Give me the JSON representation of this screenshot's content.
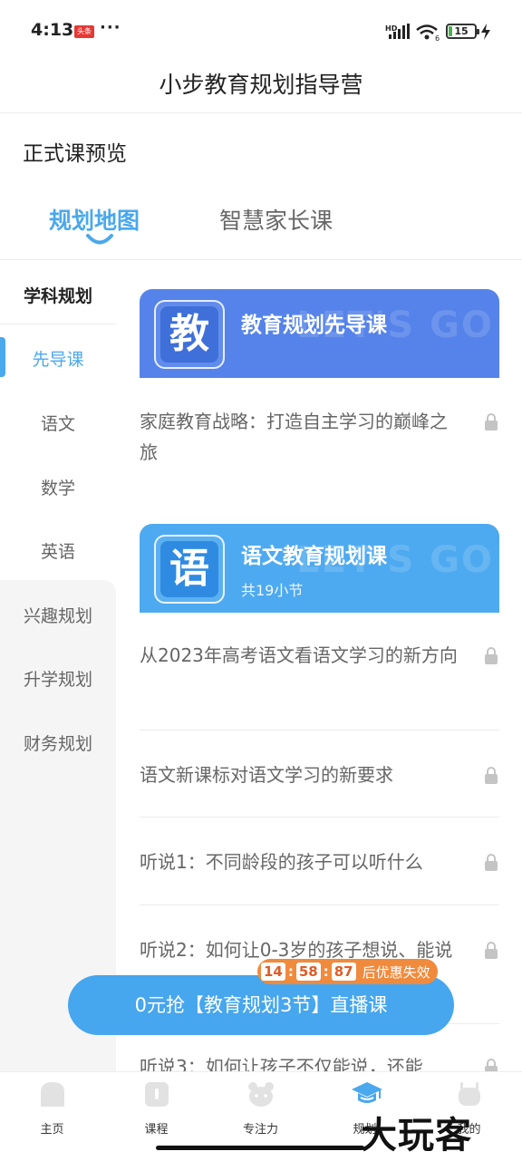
{
  "status_bar": {
    "time": "4:13",
    "notification_badge": "头条",
    "more": "···",
    "network": "HD",
    "wifi_gen": "6",
    "battery": "15"
  },
  "header": {
    "title": "小步教育规划指导营"
  },
  "section": {
    "title": "正式课预览"
  },
  "tabs": [
    {
      "label": "规划地图",
      "active": true
    },
    {
      "label": "智慧家长课",
      "active": false
    }
  ],
  "sidebar": {
    "subject_heading": "学科规划",
    "items": [
      {
        "label": "先导课",
        "active": true
      },
      {
        "label": "语文"
      },
      {
        "label": "数学"
      },
      {
        "label": "英语"
      },
      {
        "label": "兴趣规划"
      },
      {
        "label": "升学规划"
      },
      {
        "label": "财务规划"
      }
    ]
  },
  "banners": [
    {
      "icon_char": "教",
      "title": "教育规划先导课",
      "subtitle": "",
      "deco": "LET'S GO"
    },
    {
      "icon_char": "语",
      "title": "语文教育规划课",
      "subtitle": "共19小节",
      "deco": "LET'S GO"
    }
  ],
  "lessons": [
    {
      "title": "家庭教育战略：打造自主学习的巅峰之旅",
      "locked": true
    },
    {
      "title": "从2023年高考语文看语文学习的新方向",
      "locked": true
    },
    {
      "title": "语文新课标对语文学习的新要求",
      "locked": true
    },
    {
      "title": "听说1：不同龄段的孩子可以听什么",
      "locked": true
    },
    {
      "title": "听说2：如何让0-3岁的孩子想说、能说",
      "locked": true
    },
    {
      "title": "听说3：如何让孩子不仅能说，还能",
      "locked": true
    }
  ],
  "cta": {
    "label": "0元抢【教育规划3节】直播课",
    "countdown": {
      "h": "14",
      "m": "58",
      "s": "87",
      "text": "后优惠失效"
    }
  },
  "bottom_nav": [
    {
      "label": "主页",
      "icon": "home-icon"
    },
    {
      "label": "课程",
      "icon": "course-icon"
    },
    {
      "label": "专注力",
      "icon": "focus-icon"
    },
    {
      "label": "规划",
      "icon": "graduation-cap-icon",
      "active": true
    },
    {
      "label": "我的",
      "icon": "profile-icon"
    }
  ],
  "watermark": "大玩客",
  "colors": {
    "accent": "#4aa8ec",
    "banner1": "#5583ea",
    "banner2": "#4eaaf0",
    "countdown": "#f08a3c"
  }
}
